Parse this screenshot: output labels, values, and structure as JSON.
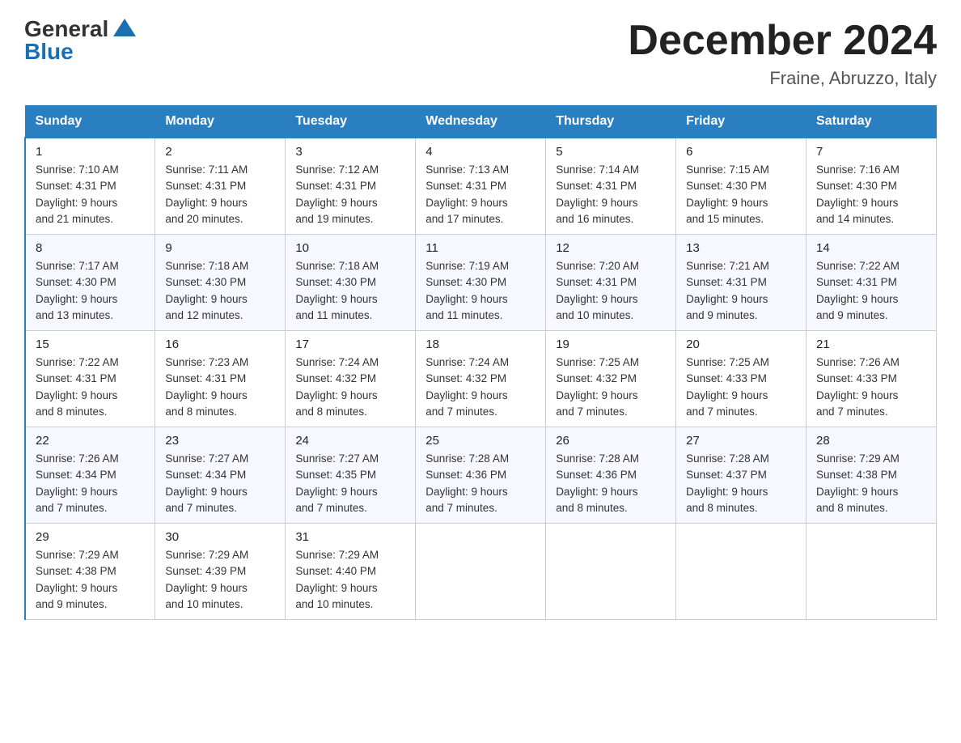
{
  "header": {
    "logo_general": "General",
    "logo_blue": "Blue",
    "month_title": "December 2024",
    "location": "Fraine, Abruzzo, Italy"
  },
  "weekdays": [
    "Sunday",
    "Monday",
    "Tuesday",
    "Wednesday",
    "Thursday",
    "Friday",
    "Saturday"
  ],
  "weeks": [
    [
      {
        "day": "1",
        "sunrise": "7:10 AM",
        "sunset": "4:31 PM",
        "daylight": "9 hours and 21 minutes."
      },
      {
        "day": "2",
        "sunrise": "7:11 AM",
        "sunset": "4:31 PM",
        "daylight": "9 hours and 20 minutes."
      },
      {
        "day": "3",
        "sunrise": "7:12 AM",
        "sunset": "4:31 PM",
        "daylight": "9 hours and 19 minutes."
      },
      {
        "day": "4",
        "sunrise": "7:13 AM",
        "sunset": "4:31 PM",
        "daylight": "9 hours and 17 minutes."
      },
      {
        "day": "5",
        "sunrise": "7:14 AM",
        "sunset": "4:31 PM",
        "daylight": "9 hours and 16 minutes."
      },
      {
        "day": "6",
        "sunrise": "7:15 AM",
        "sunset": "4:30 PM",
        "daylight": "9 hours and 15 minutes."
      },
      {
        "day": "7",
        "sunrise": "7:16 AM",
        "sunset": "4:30 PM",
        "daylight": "9 hours and 14 minutes."
      }
    ],
    [
      {
        "day": "8",
        "sunrise": "7:17 AM",
        "sunset": "4:30 PM",
        "daylight": "9 hours and 13 minutes."
      },
      {
        "day": "9",
        "sunrise": "7:18 AM",
        "sunset": "4:30 PM",
        "daylight": "9 hours and 12 minutes."
      },
      {
        "day": "10",
        "sunrise": "7:18 AM",
        "sunset": "4:30 PM",
        "daylight": "9 hours and 11 minutes."
      },
      {
        "day": "11",
        "sunrise": "7:19 AM",
        "sunset": "4:30 PM",
        "daylight": "9 hours and 11 minutes."
      },
      {
        "day": "12",
        "sunrise": "7:20 AM",
        "sunset": "4:31 PM",
        "daylight": "9 hours and 10 minutes."
      },
      {
        "day": "13",
        "sunrise": "7:21 AM",
        "sunset": "4:31 PM",
        "daylight": "9 hours and 9 minutes."
      },
      {
        "day": "14",
        "sunrise": "7:22 AM",
        "sunset": "4:31 PM",
        "daylight": "9 hours and 9 minutes."
      }
    ],
    [
      {
        "day": "15",
        "sunrise": "7:22 AM",
        "sunset": "4:31 PM",
        "daylight": "9 hours and 8 minutes."
      },
      {
        "day": "16",
        "sunrise": "7:23 AM",
        "sunset": "4:31 PM",
        "daylight": "9 hours and 8 minutes."
      },
      {
        "day": "17",
        "sunrise": "7:24 AM",
        "sunset": "4:32 PM",
        "daylight": "9 hours and 8 minutes."
      },
      {
        "day": "18",
        "sunrise": "7:24 AM",
        "sunset": "4:32 PM",
        "daylight": "9 hours and 7 minutes."
      },
      {
        "day": "19",
        "sunrise": "7:25 AM",
        "sunset": "4:32 PM",
        "daylight": "9 hours and 7 minutes."
      },
      {
        "day": "20",
        "sunrise": "7:25 AM",
        "sunset": "4:33 PM",
        "daylight": "9 hours and 7 minutes."
      },
      {
        "day": "21",
        "sunrise": "7:26 AM",
        "sunset": "4:33 PM",
        "daylight": "9 hours and 7 minutes."
      }
    ],
    [
      {
        "day": "22",
        "sunrise": "7:26 AM",
        "sunset": "4:34 PM",
        "daylight": "9 hours and 7 minutes."
      },
      {
        "day": "23",
        "sunrise": "7:27 AM",
        "sunset": "4:34 PM",
        "daylight": "9 hours and 7 minutes."
      },
      {
        "day": "24",
        "sunrise": "7:27 AM",
        "sunset": "4:35 PM",
        "daylight": "9 hours and 7 minutes."
      },
      {
        "day": "25",
        "sunrise": "7:28 AM",
        "sunset": "4:36 PM",
        "daylight": "9 hours and 7 minutes."
      },
      {
        "day": "26",
        "sunrise": "7:28 AM",
        "sunset": "4:36 PM",
        "daylight": "9 hours and 8 minutes."
      },
      {
        "day": "27",
        "sunrise": "7:28 AM",
        "sunset": "4:37 PM",
        "daylight": "9 hours and 8 minutes."
      },
      {
        "day": "28",
        "sunrise": "7:29 AM",
        "sunset": "4:38 PM",
        "daylight": "9 hours and 8 minutes."
      }
    ],
    [
      {
        "day": "29",
        "sunrise": "7:29 AM",
        "sunset": "4:38 PM",
        "daylight": "9 hours and 9 minutes."
      },
      {
        "day": "30",
        "sunrise": "7:29 AM",
        "sunset": "4:39 PM",
        "daylight": "9 hours and 10 minutes."
      },
      {
        "day": "31",
        "sunrise": "7:29 AM",
        "sunset": "4:40 PM",
        "daylight": "9 hours and 10 minutes."
      },
      null,
      null,
      null,
      null
    ]
  ],
  "labels": {
    "sunrise": "Sunrise:",
    "sunset": "Sunset:",
    "daylight": "Daylight:"
  }
}
